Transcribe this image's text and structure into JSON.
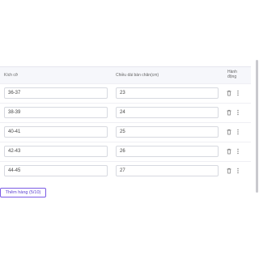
{
  "table": {
    "headers": {
      "size": "Kích cỡ",
      "length": "Chiều dài bàn chân(cm)",
      "actions_line1": "Hành",
      "actions_line2": "động"
    },
    "rows": [
      {
        "size": "36-37",
        "length": "23"
      },
      {
        "size": "38-39",
        "length": "24"
      },
      {
        "size": "40-41",
        "length": "25"
      },
      {
        "size": "42-43",
        "length": "26"
      },
      {
        "size": "44-45",
        "length": "27"
      }
    ]
  },
  "add_row_button": "Thêm hàng (5/10)",
  "icons": {
    "delete": "trash-icon",
    "drag": "drag-handle-icon"
  },
  "colors": {
    "accent": "#7b5ce5",
    "header_bg": "#f6f7fb",
    "border": "#d7d9e0"
  }
}
